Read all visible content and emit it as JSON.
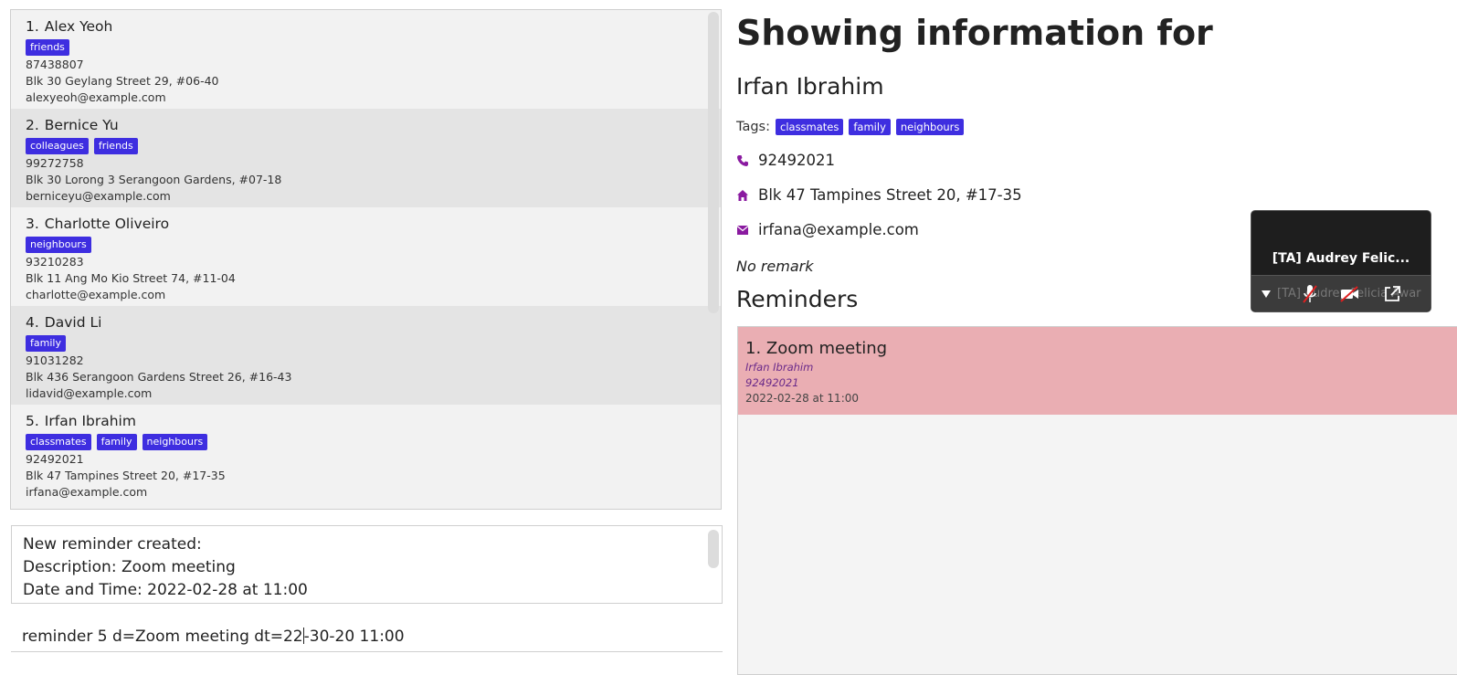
{
  "persons": [
    {
      "index": "1.",
      "name": "Alex Yeoh",
      "tags": [
        "friends"
      ],
      "phone": "87438807",
      "address": "Blk 30 Geylang Street 29, #06-40",
      "email": "alexyeoh@example.com"
    },
    {
      "index": "2.",
      "name": "Bernice Yu",
      "tags": [
        "colleagues",
        "friends"
      ],
      "phone": "99272758",
      "address": "Blk 30 Lorong 3 Serangoon Gardens, #07-18",
      "email": "berniceyu@example.com"
    },
    {
      "index": "3.",
      "name": "Charlotte Oliveiro",
      "tags": [
        "neighbours"
      ],
      "phone": "93210283",
      "address": "Blk 11 Ang Mo Kio Street 74, #11-04",
      "email": "charlotte@example.com"
    },
    {
      "index": "4.",
      "name": "David Li",
      "tags": [
        "family"
      ],
      "phone": "91031282",
      "address": "Blk 436 Serangoon Gardens Street 26, #16-43",
      "email": "lidavid@example.com"
    },
    {
      "index": "5.",
      "name": "Irfan Ibrahim",
      "tags": [
        "classmates",
        "family",
        "neighbours"
      ],
      "phone": "92492021",
      "address": "Blk 47 Tampines Street 20, #17-35",
      "email": "irfana@example.com"
    }
  ],
  "result": {
    "lines": [
      "New reminder created:",
      "Description: Zoom meeting",
      "Date and Time: 2022-02-28 at 11:00"
    ]
  },
  "command": {
    "before_caret": "reminder 5 d=Zoom meeting dt=22",
    "after_caret": "-30-20 11:00"
  },
  "detail": {
    "heading": "Showing information for",
    "name": "Irfan Ibrahim",
    "tags_label": "Tags:",
    "tags": [
      "classmates",
      "family",
      "neighbours"
    ],
    "phone": "92492021",
    "address": "Blk 47 Tampines Street 20, #17-35",
    "email": "irfana@example.com",
    "remark": "No remark",
    "reminders_title": "Reminders"
  },
  "reminders": [
    {
      "description": "1. Zoom meeting",
      "person": "Irfan Ibrahim",
      "phone": "92492021",
      "datetime": "2022-02-28 at 11:00"
    }
  ],
  "zoom_window": {
    "participant": "[TA] Audrey Felic...",
    "overlay_text": "[TA] Audrey Felicia Awar"
  },
  "colors": {
    "tag": "#3e2ee0",
    "icon": "#8a1aa0",
    "reminder_card": "#eaaeb3"
  }
}
